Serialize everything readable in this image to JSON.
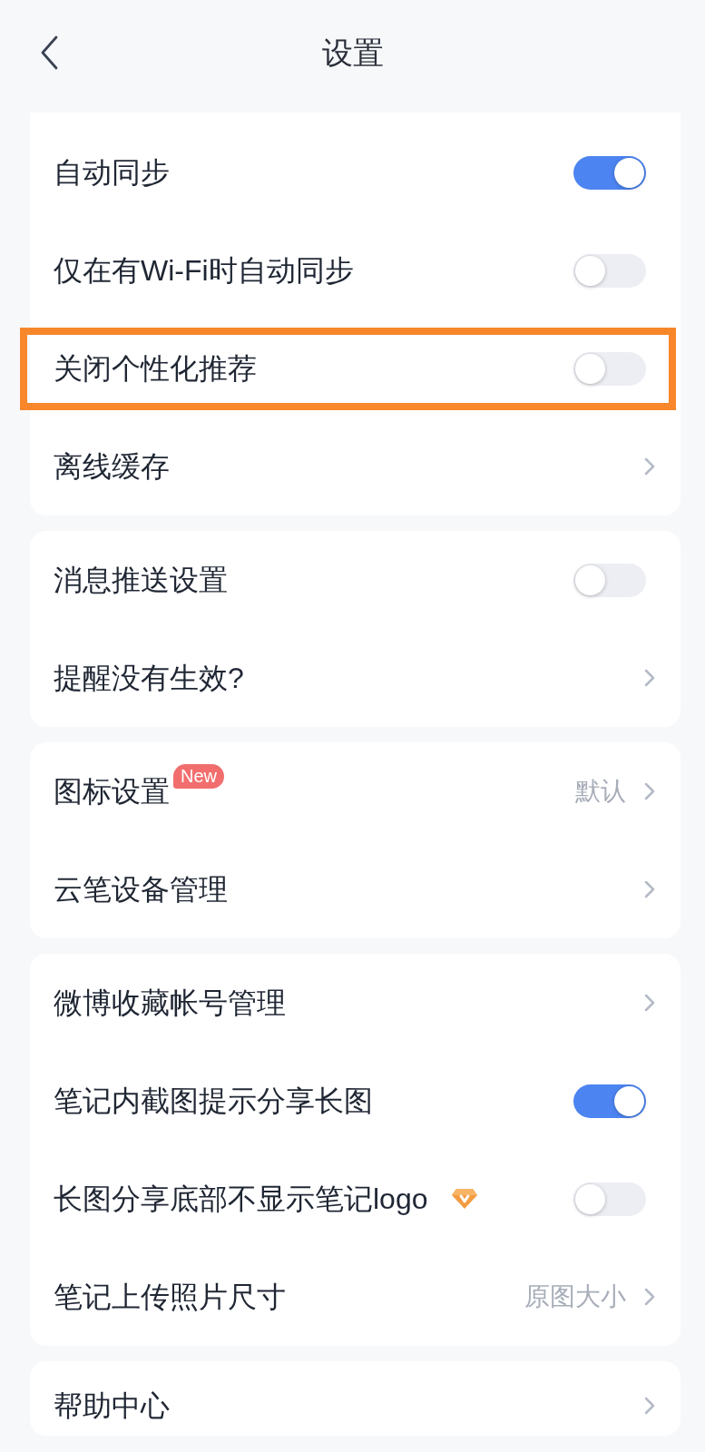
{
  "header": {
    "title": "设置"
  },
  "sections": [
    {
      "rows": [
        {
          "kind": "toggle",
          "label": "自动同步",
          "on": true,
          "highlighted": false,
          "vip": false
        },
        {
          "kind": "toggle",
          "label": "仅在有Wi-Fi时自动同步",
          "on": false,
          "highlighted": false,
          "vip": false
        },
        {
          "kind": "toggle",
          "label": "关闭个性化推荐",
          "on": false,
          "highlighted": true,
          "vip": false
        },
        {
          "kind": "link",
          "label": "离线缓存",
          "highlighted": false,
          "vip": false
        }
      ]
    },
    {
      "rows": [
        {
          "kind": "toggle",
          "label": "消息推送设置",
          "on": false,
          "highlighted": false,
          "vip": false
        },
        {
          "kind": "link",
          "label": "提醒没有生效?",
          "highlighted": false,
          "vip": false
        }
      ]
    },
    {
      "rows": [
        {
          "kind": "link",
          "label": "图标设置",
          "badge": "New",
          "value": "默认",
          "highlighted": false,
          "vip": false
        },
        {
          "kind": "link",
          "label": "云笔设备管理",
          "highlighted": false,
          "vip": false
        }
      ]
    },
    {
      "rows": [
        {
          "kind": "link",
          "label": "微博收藏帐号管理",
          "highlighted": false,
          "vip": false
        },
        {
          "kind": "toggle",
          "label": "笔记内截图提示分享长图",
          "on": true,
          "highlighted": false,
          "vip": false
        },
        {
          "kind": "toggle",
          "label": "长图分享底部不显示笔记logo",
          "on": false,
          "highlighted": false,
          "vip": true
        },
        {
          "kind": "link",
          "label": "笔记上传照片尺寸",
          "value": "原图大小",
          "highlighted": false,
          "vip": false
        }
      ]
    },
    {
      "rows": [
        {
          "kind": "link",
          "label": "帮助中心",
          "highlighted": false,
          "vip": false
        }
      ]
    }
  ]
}
